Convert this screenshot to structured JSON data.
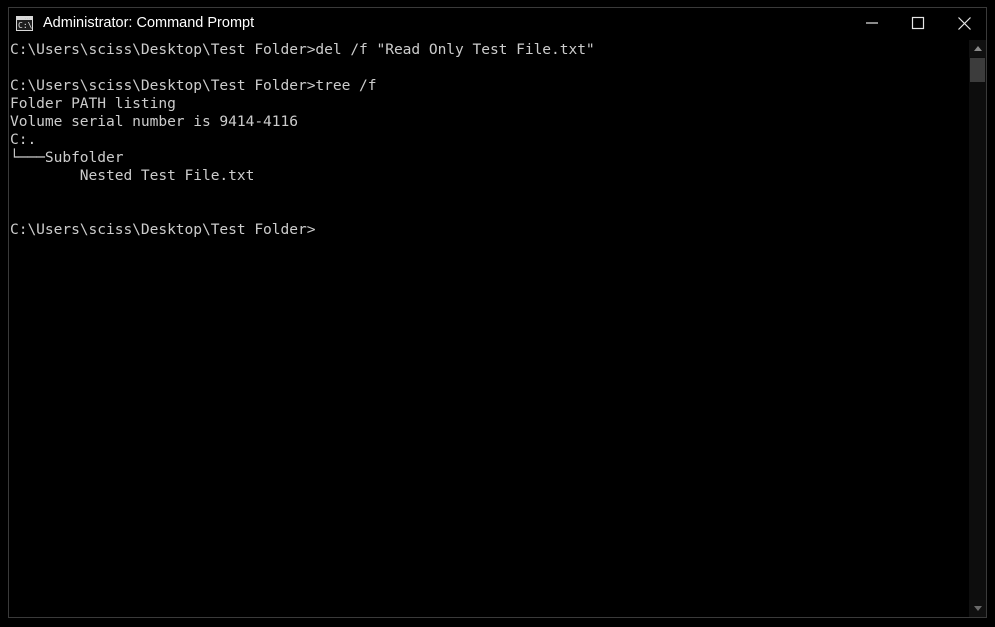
{
  "window": {
    "title": "Administrator: Command Prompt",
    "icon": "console-icon",
    "icon_text": "C:\\",
    "controls": {
      "minimize_label": "Minimize",
      "maximize_label": "Maximize",
      "close_label": "Close"
    }
  },
  "console": {
    "background_color": "#000000",
    "text_color": "#cccccc",
    "lines": [
      "C:\\Users\\sciss\\Desktop\\Test Folder>del /f \"Read Only Test File.txt\"",
      "",
      "C:\\Users\\sciss\\Desktop\\Test Folder>tree /f",
      "Folder PATH listing",
      "Volume serial number is 9414-4116",
      "C:.",
      "└───Subfolder",
      "        Nested Test File.txt",
      "",
      "",
      "C:\\Users\\sciss\\Desktop\\Test Folder>"
    ],
    "text": "C:\\Users\\sciss\\Desktop\\Test Folder>del /f \"Read Only Test File.txt\"\n\nC:\\Users\\sciss\\Desktop\\Test Folder>tree /f\nFolder PATH listing\nVolume serial number is 9414-4116\nC:.\n└───Subfolder\n        Nested Test File.txt\n\n\nC:\\Users\\sciss\\Desktop\\Test Folder>",
    "commands": [
      "del /f \"Read Only Test File.txt\"",
      "tree /f"
    ],
    "prompt": "C:\\Users\\sciss\\Desktop\\Test Folder>",
    "volume_serial_number": "9414-4116"
  },
  "scrollbar": {
    "up_arrow": "scroll-up-arrow",
    "down_arrow": "scroll-down-arrow",
    "thumb": "scroll-thumb"
  }
}
